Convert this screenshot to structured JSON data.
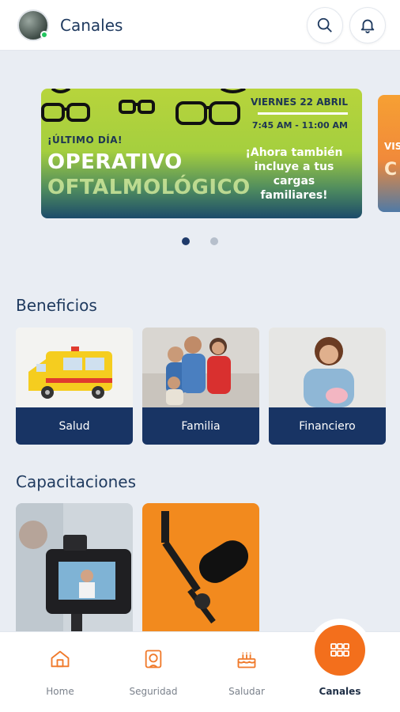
{
  "header": {
    "title": "Canales"
  },
  "banner": {
    "tag": "¡ÚLTIMO DÍA!",
    "title_line1": "OPERATIVO",
    "title_line2": "OFTALMOLÓGICO",
    "date": "VIERNES 22 ABRIL",
    "hours": "7:45 AM - 11:00 AM",
    "promo": "¡Ahora también incluye a tus cargas familiares!"
  },
  "banner_next": {
    "line1": "VIS",
    "line2": "C"
  },
  "carousel": {
    "total": 2,
    "active_index": 0
  },
  "benefits": {
    "title": "Beneficios",
    "items": [
      {
        "label": "Salud"
      },
      {
        "label": "Familia"
      },
      {
        "label": "Financiero"
      }
    ]
  },
  "trainings": {
    "title": "Capacitaciones"
  },
  "nav": {
    "items": [
      {
        "label": "Home",
        "icon": "home-icon"
      },
      {
        "label": "Seguridad",
        "icon": "shield-icon"
      },
      {
        "label": "Saludar",
        "icon": "cake-icon"
      },
      {
        "label": "Canales",
        "icon": "grid-icon"
      }
    ],
    "active": "Canales"
  },
  "colors": {
    "accent": "#f36f1c",
    "navy": "#183464",
    "title": "#1f3a5f"
  }
}
